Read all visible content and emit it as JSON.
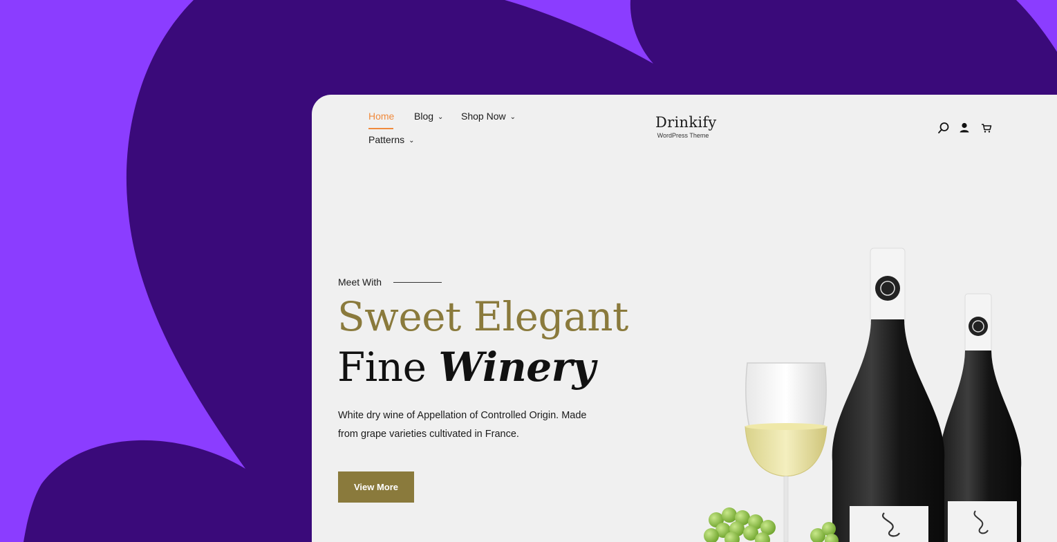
{
  "colors": {
    "outer_bg": "#3a0a7a",
    "accent_purple": "#8b3dff",
    "page_bg": "#f0f0f0",
    "nav_active": "#f08a3c",
    "gold": "#8a7a3c"
  },
  "nav": {
    "items": [
      {
        "label": "Home"
      },
      {
        "label": "Blog"
      },
      {
        "label": "Shop Now"
      },
      {
        "label": "Patterns"
      }
    ]
  },
  "brand": {
    "name": "Drinkify",
    "tagline": "WordPress Theme"
  },
  "header_icons": [
    "search-icon",
    "user-icon",
    "cart-icon"
  ],
  "hero": {
    "eyebrow": "Meet With",
    "title_line1": "Sweet Elegant",
    "title_line2_plain": "Fine",
    "title_line2_emph": "Winery",
    "description": "White dry wine of Appellation of Controlled Origin. Made from grape varieties cultivated in France.",
    "cta_label": "View More"
  }
}
